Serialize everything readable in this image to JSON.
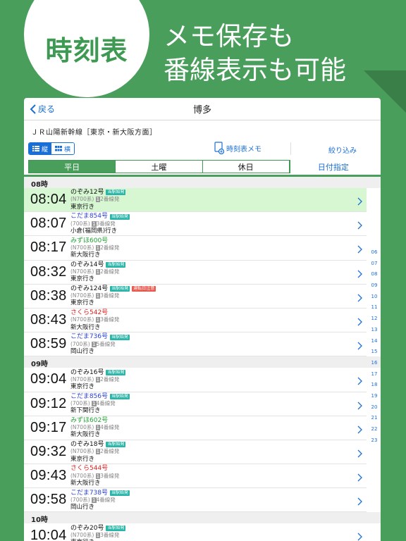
{
  "promo": {
    "badge": "時刻表",
    "line1": "メモ保存も",
    "line2": "番線表示も可能"
  },
  "nav": {
    "back_label": "戻る",
    "title": "博多"
  },
  "line_name": "ＪＲ山陽新幹線［東京・新大阪方面］",
  "toolbar": {
    "view_vertical": "縦",
    "view_horizontal": "横",
    "memo_label": "時刻表メモ",
    "filter_label": "絞り込み"
  },
  "tabs": [
    "平日",
    "土曜",
    "休日",
    "日付指定"
  ],
  "groups": [
    {
      "hour": "08時",
      "rows": [
        {
          "time": "08:04",
          "name": "のぞみ12号",
          "kind": "nozomi",
          "tags": [
            "当駅始発"
          ],
          "car": "(N700系)",
          "plat": "1",
          "track": "2番線発",
          "dest": "東京行き",
          "hl": true
        },
        {
          "time": "08:07",
          "name": "こだま854号",
          "kind": "kodama",
          "tags": [
            "当駅始発"
          ],
          "car": "(700系)",
          "plat": "1",
          "track": "3番線発",
          "dest": "小倉(福岡県)行き",
          "hl": false
        },
        {
          "time": "08:17",
          "name": "みずほ600号",
          "kind": "mizuho",
          "tags": [],
          "car": "(N700系)",
          "plat": "1",
          "track": "2番線発",
          "dest": "新大阪行き",
          "hl": false
        },
        {
          "time": "08:32",
          "name": "のぞみ14号",
          "kind": "nozomi",
          "tags": [
            "当駅始発"
          ],
          "car": "(N700系)",
          "plat": "1",
          "track": "2番線発",
          "dest": "東京行き",
          "hl": false
        },
        {
          "time": "08:38",
          "name": "のぞみ124号",
          "kind": "nozomi",
          "tags": [
            "当駅始発",
            "運転日注意"
          ],
          "car": "(N700系)",
          "plat": "1",
          "track": "3番線発",
          "dest": "東京行き",
          "hl": false
        },
        {
          "time": "08:43",
          "name": "さくら542号",
          "kind": "sakura",
          "tags": [],
          "car": "(N700系)",
          "plat": "1",
          "track": "3番線発",
          "dest": "新大阪行き",
          "hl": false
        },
        {
          "time": "08:59",
          "name": "こだま736号",
          "kind": "kodama",
          "tags": [
            "当駅始発"
          ],
          "car": "(700系)",
          "plat": "1",
          "track": "5番線発",
          "dest": "岡山行き",
          "hl": false
        }
      ]
    },
    {
      "hour": "09時",
      "rows": [
        {
          "time": "09:04",
          "name": "のぞみ16号",
          "kind": "nozomi",
          "tags": [
            "当駅始発"
          ],
          "car": "(N700系)",
          "plat": "1",
          "track": "2番線発",
          "dest": "東京行き",
          "hl": false
        },
        {
          "time": "09:12",
          "name": "こだま856号",
          "kind": "kodama",
          "tags": [
            "当駅始発"
          ],
          "car": "(700系)",
          "plat": "1",
          "track": "4番線発",
          "dest": "新下関行き",
          "hl": false
        },
        {
          "time": "09:17",
          "name": "みずほ602号",
          "kind": "mizuho",
          "tags": [],
          "car": "(N700系)",
          "plat": "1",
          "track": "4番線発",
          "dest": "新大阪行き",
          "hl": false
        },
        {
          "time": "09:32",
          "name": "のぞみ18号",
          "kind": "nozomi",
          "tags": [
            "当駅始発"
          ],
          "car": "(N700系)",
          "plat": "1",
          "track": "2番線発",
          "dest": "東京行き",
          "hl": false
        },
        {
          "time": "09:43",
          "name": "さくら544号",
          "kind": "sakura",
          "tags": [],
          "car": "(N700系)",
          "plat": "1",
          "track": "3番線発",
          "dest": "新大阪行き",
          "hl": false
        },
        {
          "time": "09:58",
          "name": "こだま738号",
          "kind": "kodama",
          "tags": [
            "当駅始発"
          ],
          "car": "(700系)",
          "plat": "1",
          "track": "4番線発",
          "dest": "岡山行き",
          "hl": false
        }
      ]
    },
    {
      "hour": "10時",
      "rows": [
        {
          "time": "10:04",
          "name": "のぞみ20号",
          "kind": "nozomi",
          "tags": [
            "当駅始発"
          ],
          "car": "(N700系)",
          "plat": "1",
          "track": "3番線発",
          "dest": "東京行き",
          "hl": false
        }
      ]
    }
  ],
  "hour_index": [
    "06",
    "07",
    "08",
    "09",
    "10",
    "11",
    "12",
    "13",
    "14",
    "15",
    "16",
    "17",
    "18",
    "19",
    "20",
    "21",
    "22",
    "23"
  ]
}
